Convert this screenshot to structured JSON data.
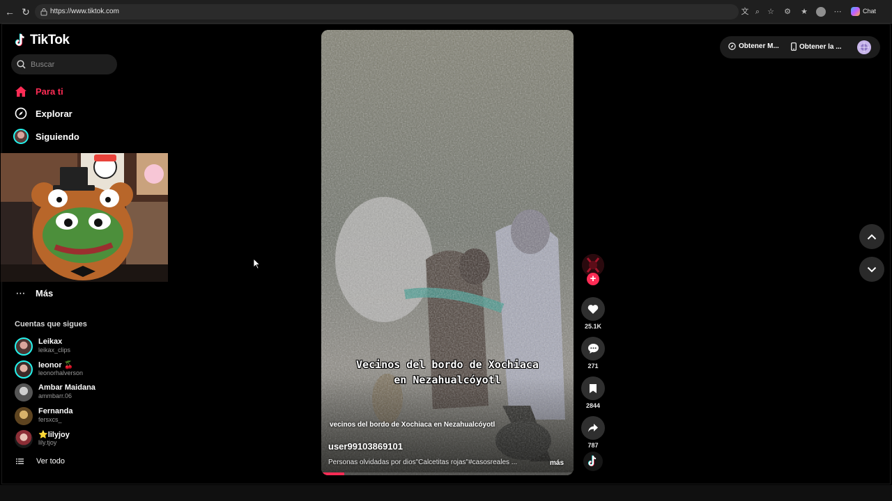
{
  "browser": {
    "url": "https://www.tiktok.com",
    "chat_label": "Chat"
  },
  "sidebar": {
    "logo_text": "TikTok",
    "search_placeholder": "Buscar",
    "nav": [
      {
        "label": "Para ti",
        "icon": "home-icon",
        "active": true
      },
      {
        "label": "Explorar",
        "icon": "compass-icon",
        "active": false
      },
      {
        "label": "Siguiendo",
        "icon": "following-avatar-icon",
        "active": false
      }
    ],
    "more_label": "Más",
    "following_title": "Cuentas que sigues",
    "accounts": [
      {
        "name": "Leikax",
        "handle": "leikax_clips"
      },
      {
        "name": "leonor 🍒",
        "handle": "leonorhalverson"
      },
      {
        "name": "Ambar Maidana",
        "handle": "ammbarr.06"
      },
      {
        "name": "Fernanda",
        "handle": "fersxcs_"
      },
      {
        "name": "⭐lilyjoy",
        "handle": "lily.tjoy"
      }
    ],
    "see_all_label": "Ver todo"
  },
  "video": {
    "caption_line1": "Vecinos del bordo de Xochiaca",
    "caption_line2": "en Nezahualcóyotl",
    "overlay_title": "vecinos del bordo de Xochiaca en Nezahualcóyotl",
    "author": "user99103869101",
    "description": "Personas olvidadas por dios\"Calcetitas rojas\"#casosreales ...",
    "more_label": "más",
    "progress": 0.09
  },
  "actions": {
    "likes": "25.1K",
    "comments": "271",
    "saves": "2844",
    "shares": "787"
  },
  "top_actions": {
    "coins_label": "Obtener M...",
    "app_label": "Obtener la ..."
  },
  "colors": {
    "accent": "#fe2c55",
    "background": "#000000"
  }
}
